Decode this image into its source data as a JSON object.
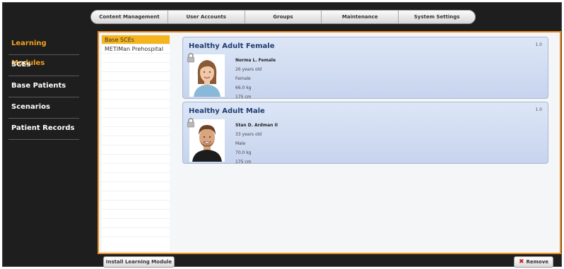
{
  "topbar": {
    "tabs": [
      {
        "label": "Content Management"
      },
      {
        "label": "User Accounts"
      },
      {
        "label": "Groups"
      },
      {
        "label": "Maintenance"
      },
      {
        "label": "System Settings"
      }
    ]
  },
  "sidebar": {
    "items": [
      {
        "label": "Learning Modules",
        "active": true
      },
      {
        "label": "SCEs"
      },
      {
        "label": "Base Patients"
      },
      {
        "label": "Scenarios"
      },
      {
        "label": "Patient Records"
      }
    ]
  },
  "modules": {
    "items": [
      {
        "label": "Base SCEs",
        "selected": true
      },
      {
        "label": "METIMan Prehospital"
      }
    ]
  },
  "patients": [
    {
      "title": "Healthy Adult Female",
      "version": "1.0",
      "name": "Norma L. Female",
      "age": "26 years old",
      "sex": "Female",
      "weight": "66.0 kg",
      "height": "175 cm",
      "photo_icon": "female-portrait-icon"
    },
    {
      "title": "Healthy Adult Male",
      "version": "1.0",
      "name": "Stan D. Ardman II",
      "age": "33 years old",
      "sex": "Male",
      "weight": "70.0 kg",
      "height": "175 cm",
      "photo_icon": "male-portrait-icon"
    }
  ],
  "footer": {
    "install_label": "Install Learning Module",
    "remove_label": "Remove"
  },
  "colors": {
    "accent": "#e8891c",
    "active_text": "#f0a020",
    "selected_row": "#f5b31c",
    "card_bg": "#c7d4ee",
    "card_title": "#1f3d6e"
  }
}
